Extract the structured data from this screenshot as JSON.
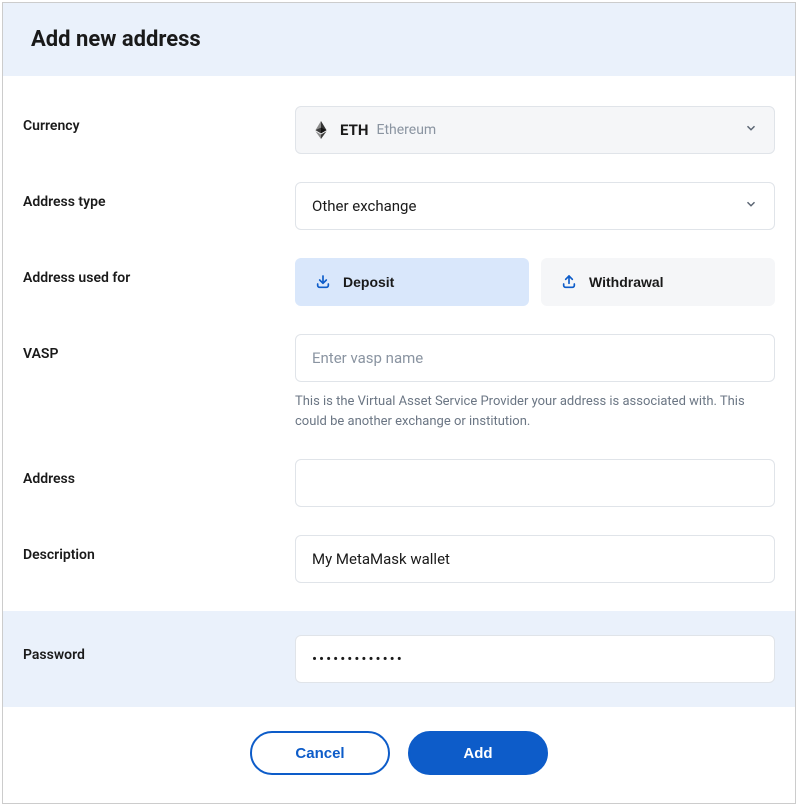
{
  "header": {
    "title": "Add new address"
  },
  "labels": {
    "currency": "Currency",
    "address_type": "Address type",
    "address_used_for": "Address used for",
    "vasp": "VASP",
    "address": "Address",
    "description": "Description",
    "password": "Password"
  },
  "currency": {
    "symbol": "ETH",
    "name": "Ethereum"
  },
  "address_type": {
    "selected": "Other exchange"
  },
  "used_for": {
    "deposit_label": "Deposit",
    "withdrawal_label": "Withdrawal",
    "selected": "deposit"
  },
  "vasp": {
    "value": "",
    "placeholder": "Enter vasp name",
    "help": "This is the Virtual Asset Service Provider your address is associated with. This could be another exchange or institution."
  },
  "address": {
    "value": ""
  },
  "description": {
    "value": "My MetaMask wallet"
  },
  "password": {
    "masked": "•••••••••••••"
  },
  "footer": {
    "cancel": "Cancel",
    "add": "Add"
  }
}
